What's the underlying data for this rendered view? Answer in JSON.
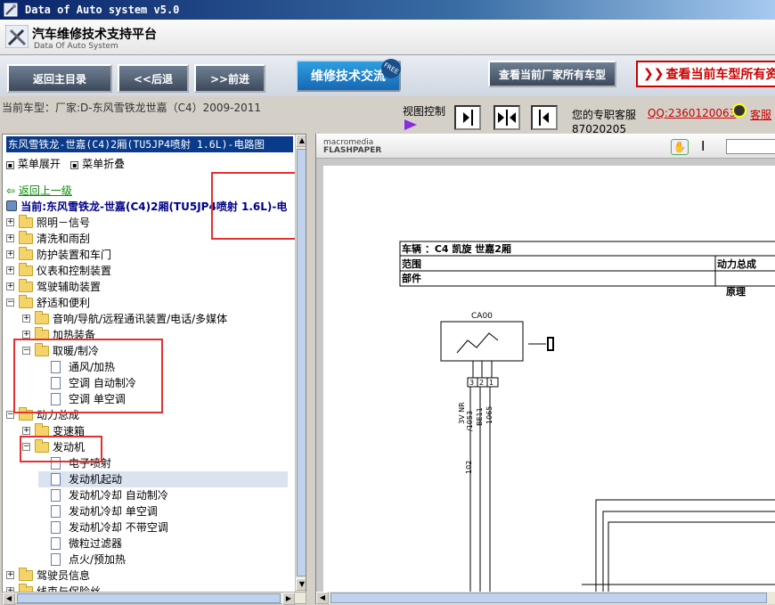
{
  "window": {
    "title": "Data of Auto system v5.0"
  },
  "header": {
    "title": "汽车维修技术支持平台",
    "subtitle": "Data Of Auto System"
  },
  "nav": {
    "home": "返回主目录",
    "back": "<<后退",
    "forward": ">>前进",
    "forum": "维修技术交流",
    "free_badge": "FREE",
    "all_models": "查看当前厂家所有车型",
    "all_info": "查看当前车型所有资"
  },
  "info": {
    "current_model": "当前车型：厂家:D-东风雪铁龙世嘉（C4）2009-2011",
    "view_control": "视图控制",
    "service": "您的专职客服",
    "qq": "QQ:2360120063",
    "kefu": "客服",
    "phone": "87020205"
  },
  "tree": {
    "title": "东风雪铁龙-世嘉(C4)2厢(TU5JP4喷射 1.6L)-电路图",
    "expand": "菜单展开",
    "collapse": "菜单折叠",
    "up": "返回上一级",
    "current": "当前:东风雪铁龙-世嘉(C4)2厢(TU5JP4喷射 1.6L)-电",
    "items": [
      {
        "label": "照明－信号",
        "pm": "+"
      },
      {
        "label": "清洗和雨刮",
        "pm": "+"
      },
      {
        "label": "防护装置和车门",
        "pm": "+"
      },
      {
        "label": "仪表和控制装置",
        "pm": "+"
      },
      {
        "label": "驾驶辅助装置",
        "pm": "+"
      },
      {
        "label": "舒适和便利",
        "pm": "−"
      },
      {
        "label": "音响/导航/远程通讯装置/电话/多媒体",
        "pm": "+"
      },
      {
        "label": "加热装备",
        "pm": "+"
      },
      {
        "label": "取暖/制冷",
        "pm": "−"
      },
      {
        "label": "通风/加热"
      },
      {
        "label": "空调 自动制冷"
      },
      {
        "label": "空调 单空调"
      },
      {
        "label": "动力总成",
        "pm": "−"
      },
      {
        "label": "变速箱",
        "pm": "+"
      },
      {
        "label": "发动机",
        "pm": "−"
      },
      {
        "label": "电子喷射"
      },
      {
        "label": "发动机起动"
      },
      {
        "label": "发动机冷却 自动制冷"
      },
      {
        "label": "发动机冷却 单空调"
      },
      {
        "label": "发动机冷却 不带空调"
      },
      {
        "label": "微粒过滤器"
      },
      {
        "label": "点火/预加热"
      },
      {
        "label": "驾驶员信息",
        "pm": "+"
      },
      {
        "label": "线束与保险丝",
        "pm": "+"
      }
    ]
  },
  "viewer": {
    "logo_line1": "macromedia",
    "logo_line2": "FLASHPAPER",
    "vehicle": "车辆 ：C4 凯旋 世嘉2厢",
    "scope": "范围",
    "part": "部件",
    "system": "动力总成",
    "principle": "原理",
    "component": "CA00",
    "pins": [
      "3",
      "2",
      "1"
    ],
    "wires": [
      "3V NR",
      "/1053",
      "BE11",
      "1065"
    ],
    "wire_num": "102"
  }
}
